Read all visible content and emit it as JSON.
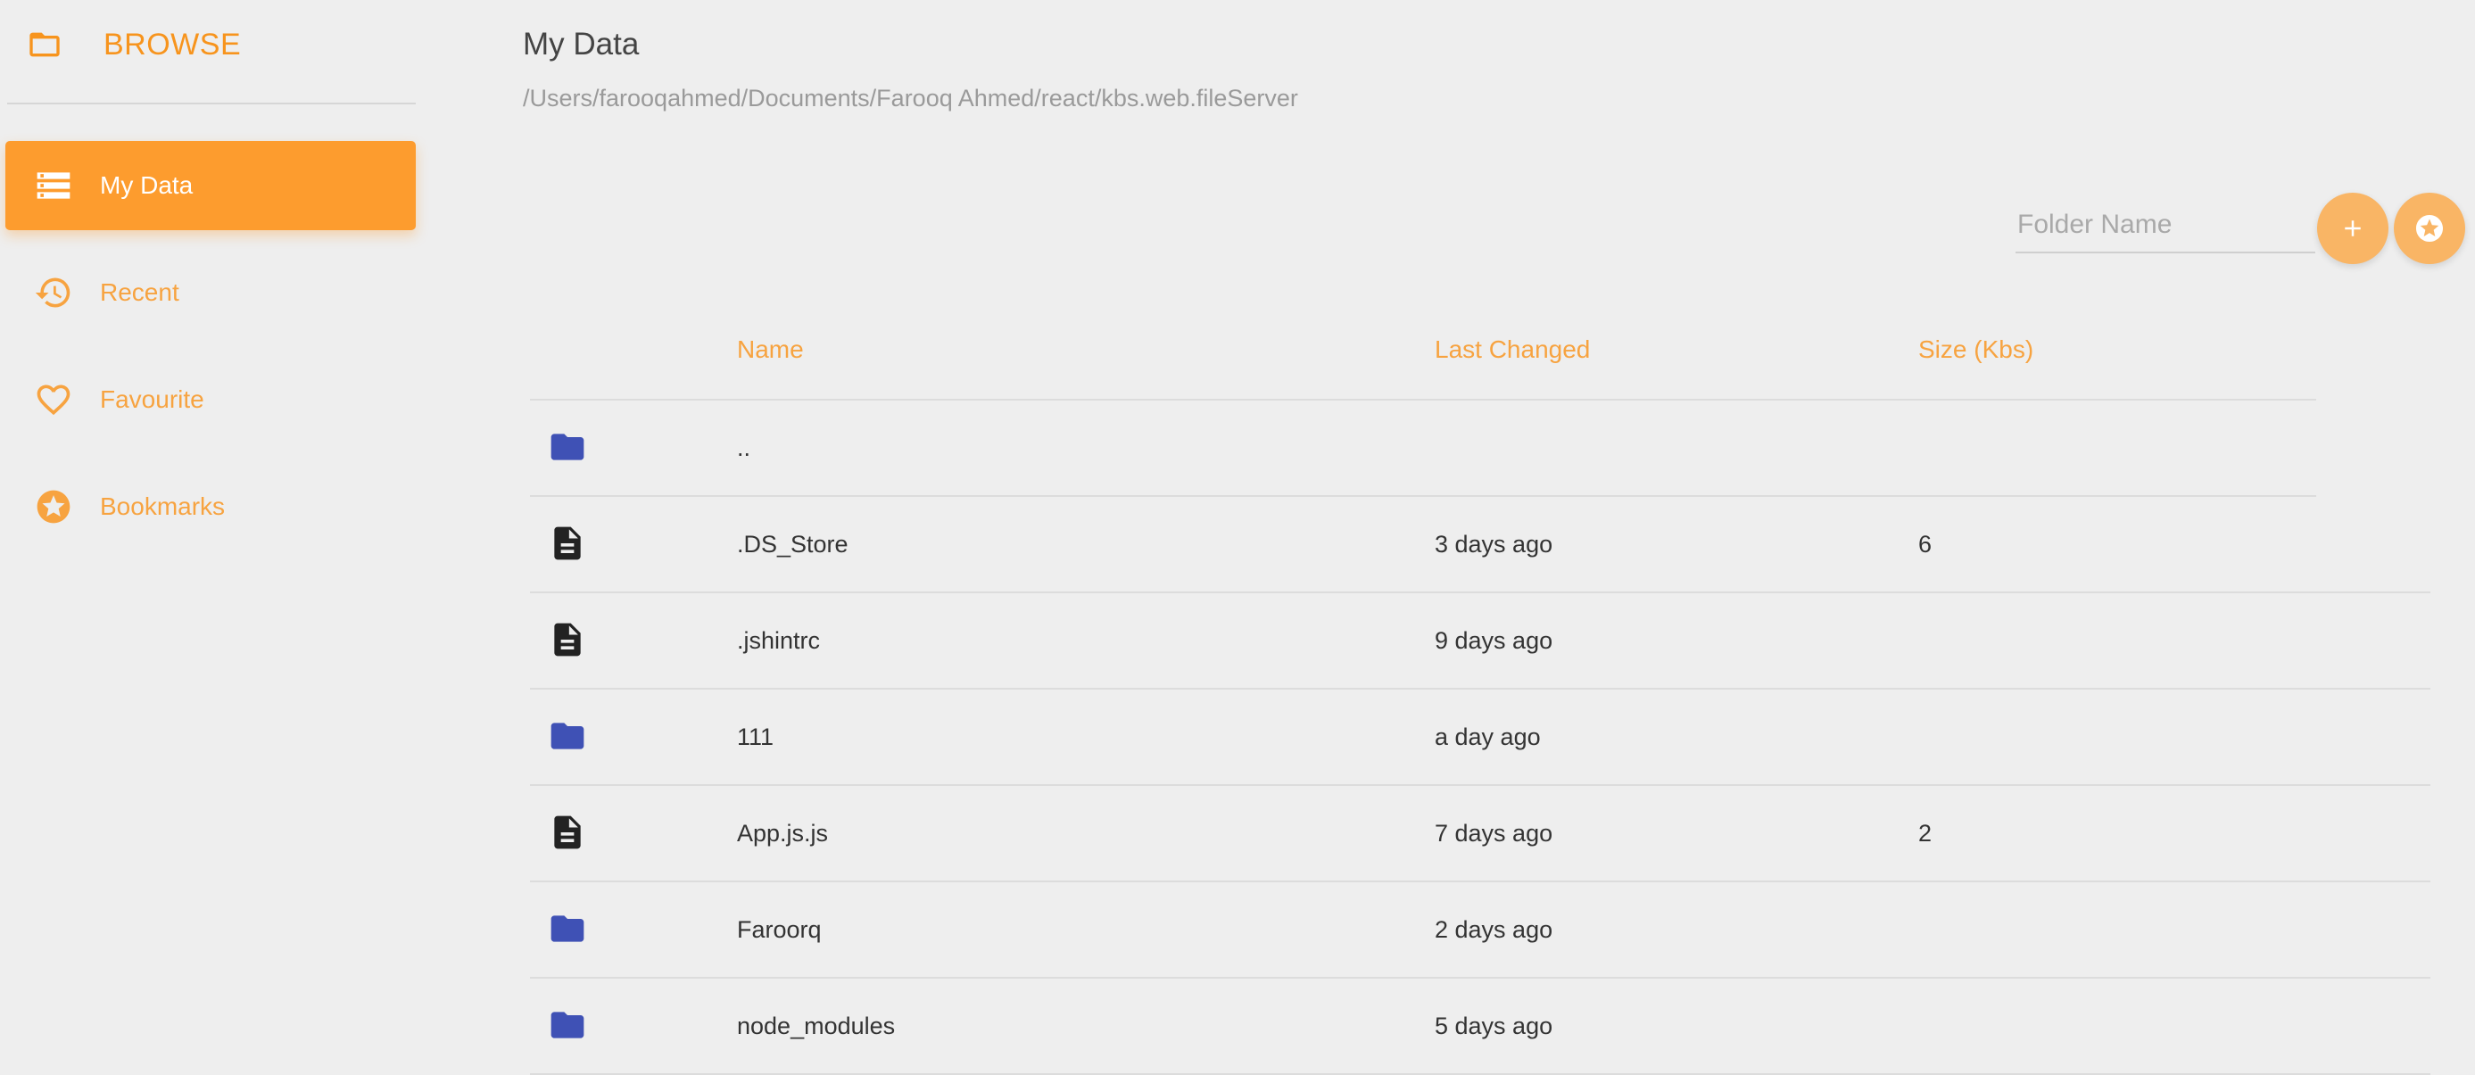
{
  "sidebar": {
    "brand": "BROWSE",
    "items": [
      {
        "label": "My Data",
        "icon": "storage-icon",
        "active": true
      },
      {
        "label": "Recent",
        "icon": "history-icon",
        "active": false
      },
      {
        "label": "Favourite",
        "icon": "heart-icon",
        "active": false
      },
      {
        "label": "Bookmarks",
        "icon": "star-circle-icon",
        "active": false
      }
    ]
  },
  "main": {
    "title": "My Data",
    "path": "/Users/farooqahmed/Documents/Farooq Ahmed/react/kbs.web.fileServer",
    "folder_input": {
      "placeholder": "Folder Name",
      "value": ""
    },
    "actions": {
      "add": "+"
    }
  },
  "table": {
    "columns": [
      "Name",
      "Last Changed",
      "Size (Kbs)"
    ],
    "rows": [
      {
        "type": "folder",
        "name": "..",
        "changed": "",
        "size": ""
      },
      {
        "type": "file",
        "name": ".DS_Store",
        "changed": "3 days ago",
        "size": "6"
      },
      {
        "type": "file",
        "name": ".jshintrc",
        "changed": "9 days ago",
        "size": ""
      },
      {
        "type": "folder",
        "name": "111",
        "changed": "a day ago",
        "size": ""
      },
      {
        "type": "file",
        "name": "App.js.js",
        "changed": "7 days ago",
        "size": "2"
      },
      {
        "type": "folder",
        "name": "Faroorq",
        "changed": "2 days ago",
        "size": ""
      },
      {
        "type": "folder",
        "name": "node_modules",
        "changed": "5 days ago",
        "size": ""
      }
    ]
  },
  "colors": {
    "accent": "#f7941d",
    "active_bg": "#fd9c2e",
    "folder_icon": "#3f51b5",
    "file_icon": "#222222",
    "background": "#eeeeee"
  }
}
